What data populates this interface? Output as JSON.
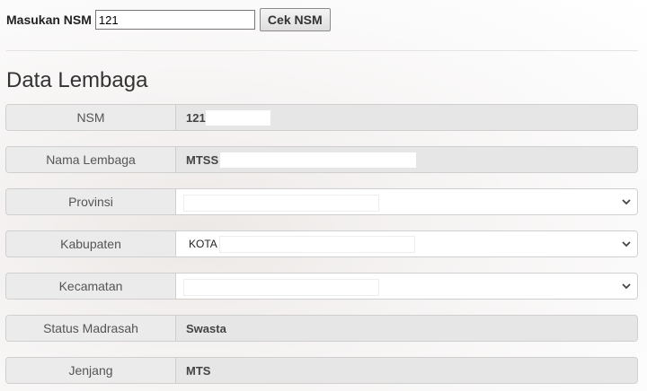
{
  "search": {
    "label": "Masukan NSM",
    "value": "121",
    "button_label": "Cek NSM"
  },
  "section_title": "Data Lembaga",
  "fields": [
    {
      "label": "NSM",
      "value": "121"
    },
    {
      "label": "Nama Lembaga",
      "value": "MTSS"
    },
    {
      "label": "Provinsi",
      "value": ""
    },
    {
      "label": "Kabupaten",
      "value": "KOTA"
    },
    {
      "label": "Kecamatan",
      "value": ""
    },
    {
      "label": "Status Madrasah",
      "value": "Swasta"
    },
    {
      "label": "Jenjang",
      "value": "MTS"
    }
  ],
  "icons": {
    "dropdown": "chevron-down-icon"
  }
}
